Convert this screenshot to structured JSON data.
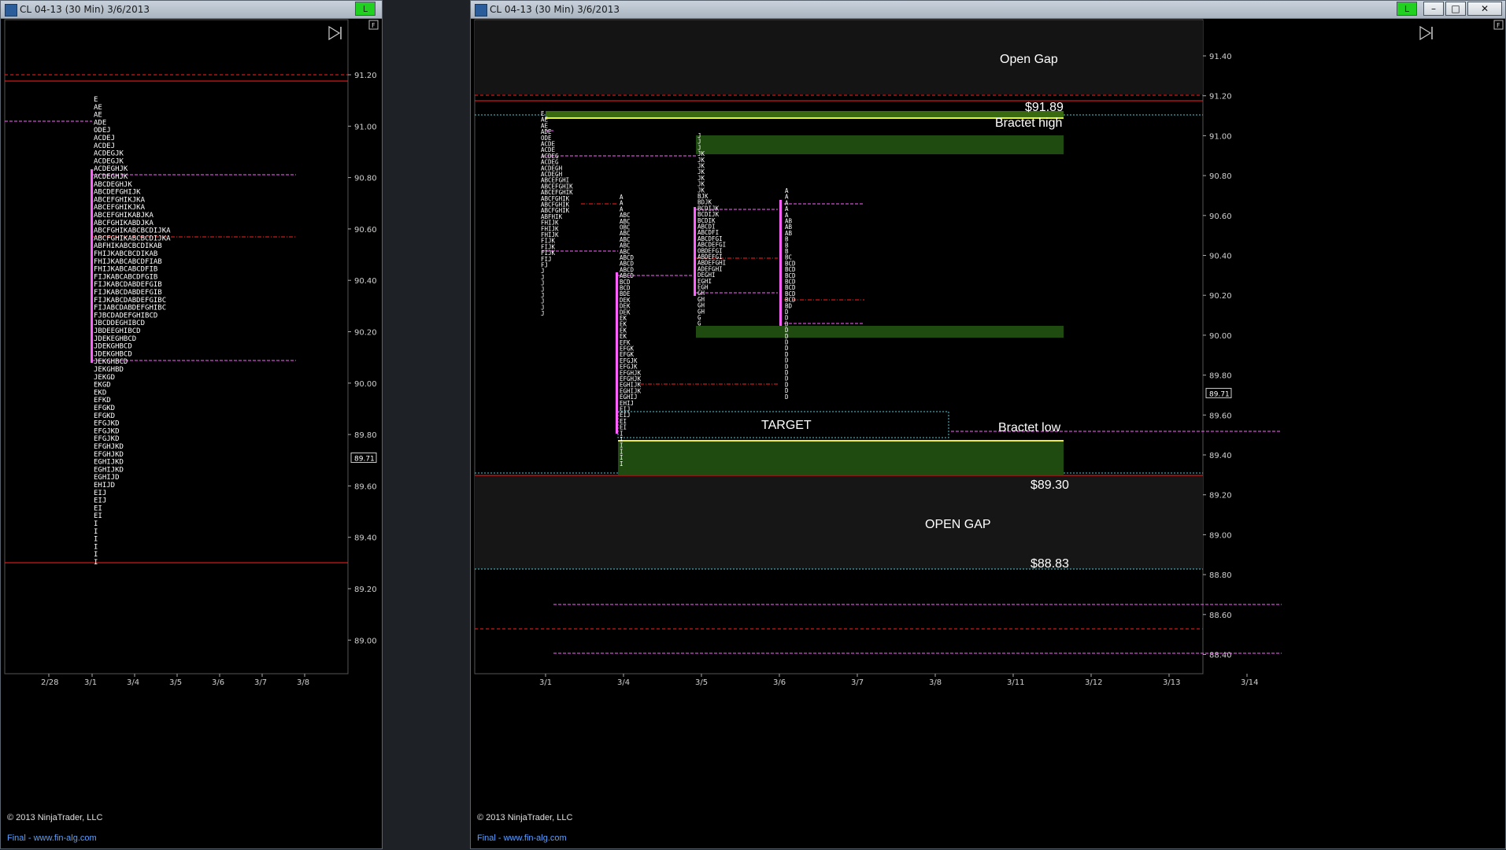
{
  "windows": [
    {
      "title": "CL 04-13 (30 Min)  3/6/2013",
      "link_label": "L",
      "buttons": {
        "minimize": "–",
        "maximize": "□",
        "close": "✕"
      },
      "chart_data": {
        "type": "table",
        "y_ticks": [
          "91.20",
          "91.00",
          "90.80",
          "90.60",
          "90.40",
          "90.20",
          "90.00",
          "89.80",
          "89.60",
          "89.40",
          "89.20",
          "89.00"
        ],
        "x_ticks": [
          "2/28",
          "3/1",
          "3/4",
          "3/5",
          "3/6",
          "3/7",
          "3/8"
        ],
        "last_price": "89.71",
        "profile_rows": [
          "E",
          "AE",
          "AE",
          "ADE",
          "ODEJ",
          "ACDEJ",
          "ACDEJ",
          "ACDEGJK",
          "ACDEGJK",
          "ACDEGHJK",
          "ACDEGHJK",
          "ABCDEGHJK",
          "ABCDEFGHIJK",
          "ABCEFGHIKJKA",
          "ABCEFGHIKJKA",
          "ABCEFGHIKABJKA",
          "ABCFGHIKABDJKA",
          "ABCFGHIKABCBCDIJKA",
          "ABCFGHIKABCBCDIJKA",
          "ABFHIKABCBCDIKAB",
          "FHIJKABCBCDIKAB",
          "FHIJKABCABCDFIAB",
          "FHIJKABCABCDFIB",
          "FIJKABCABCDFGIB",
          "FIJKABCDABDEFGIB",
          "FIJKABCDABDEFGIB",
          "FIJKABCDABDEFGIBC",
          "FIJABCDABDEFGHIBC",
          "FJBCDADEFGHIBCD",
          "JBCDDEGHIBCD",
          "JBDEEGHIBCD",
          "JDEKEGHBCD",
          "JDEKGHBCD",
          "JDEKGHBCD",
          "JEKGHBCD",
          "JEKGHBD",
          "JEKGD",
          "EKGD",
          "EKD",
          "EFKD",
          "EFGKD",
          "EFGKD",
          "EFGJKD",
          "EFGJKD",
          "EFGJKD",
          "EFGHJKD",
          "EFGHJKD",
          "EGHIJKD",
          "EGHIJKD",
          "EGHIJD",
          "EHIJD",
          "EIJ",
          "EIJ",
          "EI",
          "EI",
          "I",
          "I",
          "I",
          "I",
          "I",
          "I"
        ],
        "poc_price": 90.57,
        "value_area": [
          89.9,
          90.82
        ]
      },
      "footer": {
        "copyright": "© 2013 NinjaTrader, LLC",
        "link": "Final - www.fin-alg.com"
      }
    },
    {
      "title": "CL 04-13 (30 Min)  3/6/2013",
      "link_label": "L",
      "buttons": {
        "minimize": "–",
        "maximize": "□",
        "close": "✕"
      },
      "chart_data": {
        "type": "table",
        "y_ticks": [
          "91.40",
          "91.20",
          "91.00",
          "90.80",
          "90.60",
          "90.40",
          "90.20",
          "90.00",
          "89.80",
          "89.60",
          "89.40",
          "89.20",
          "89.00",
          "88.80",
          "88.60",
          "88.40"
        ],
        "x_ticks": [
          "3/1",
          "3/4",
          "3/5",
          "3/6",
          "3/7",
          "3/8",
          "3/11",
          "3/12",
          "3/13",
          "3/14"
        ],
        "last_price": "89.71",
        "annotations": {
          "open_gap_top": "Open Gap",
          "price_high": "$91.89",
          "bractet_high": "Bractet high",
          "target": "TARGET",
          "bractet_low": "Bractet low",
          "price_low": "$89.30",
          "open_gap_bottom": "OPEN GAP",
          "price_gap": "$88.83"
        },
        "profiles": [
          {
            "session": "3/1",
            "rows": [
              "E",
              "AE",
              "AE",
              "ADE",
              "ODE",
              "ACDE",
              "ACDE",
              "ACDEG",
              "ACDEG",
              "ACDEGH",
              "ACDEGH",
              "ABCEFGHI",
              "ABCEFGHIK",
              "ABCEFGHIK",
              "ABCFGHIK",
              "ABCFGHIK",
              "ABCFGHIK",
              "ABFHIK",
              "FHIJK",
              "FHIJK",
              "FHIJK",
              "FIJK",
              "FIJK",
              "FIJK",
              "FIJ",
              "FJ",
              "J",
              "J",
              "J",
              "J",
              "J",
              "J",
              "J",
              "J"
            ]
          },
          {
            "session": "3/4",
            "rows": [
              "A",
              "A",
              "A",
              "ABC",
              "ABC",
              "OBC",
              "ABC",
              "ABC",
              "ABC",
              "ABC",
              "ABCD",
              "ABCD",
              "ABCD",
              "ABCD",
              "BCD",
              "BCD",
              "BDE",
              "DEK",
              "DEK",
              "DEK",
              "EK",
              "EK",
              "EK",
              "EK",
              "EFK",
              "EFGK",
              "EFGK",
              "EFGJK",
              "EFGJK",
              "EFGHJK",
              "EFGHJK",
              "EGHIJK",
              "EGHIJK",
              "EGHIJ",
              "EHIJ",
              "EIJ",
              "EIJ",
              "EI",
              "EI",
              "I",
              "I",
              "I",
              "I",
              "I",
              "I"
            ]
          },
          {
            "session": "3/5",
            "rows": [
              "J",
              "J",
              "J",
              "JK",
              "JK",
              "JK",
              "JK",
              "JK",
              "JK",
              "JK",
              "BJK",
              "BDJK",
              "BCDIJK",
              "BCDIJK",
              "BCDIK",
              "ABCDI",
              "ABCDFI",
              "ABCDFGI",
              "ABCDEFGI",
              "OBDEFGI",
              "ABDEFGI",
              "ABDEFGHI",
              "ADEFGHI",
              "DEGHI",
              "EGHI",
              "EGH",
              "GH",
              "GH",
              "GH",
              "GH",
              "G",
              "G"
            ]
          },
          {
            "session": "3/6",
            "rows": [
              "A",
              "A",
              "A",
              "A",
              "A",
              "AB",
              "AB",
              "AB",
              "B",
              "B",
              "B",
              "BC",
              "BCD",
              "BCD",
              "BCD",
              "BCD",
              "BCD",
              "BCD",
              "BCD",
              "BD",
              "D",
              "D",
              "D",
              "D",
              "D",
              "D",
              "D",
              "D",
              "D",
              "D",
              "D",
              "D",
              "D",
              "D",
              "D"
            ]
          }
        ]
      },
      "footer": {
        "copyright": "© 2013 NinjaTrader, LLC",
        "link": "Final - www.fin-alg.com"
      }
    }
  ],
  "colors": {
    "background": "#000000",
    "red_line": "#ff2020",
    "magenta_line": "#ff60ff",
    "cyan_line": "#40d0e0",
    "zone_green": "#1f4a10",
    "yellow_line": "#e8f040",
    "text_white": "#ffffff"
  }
}
